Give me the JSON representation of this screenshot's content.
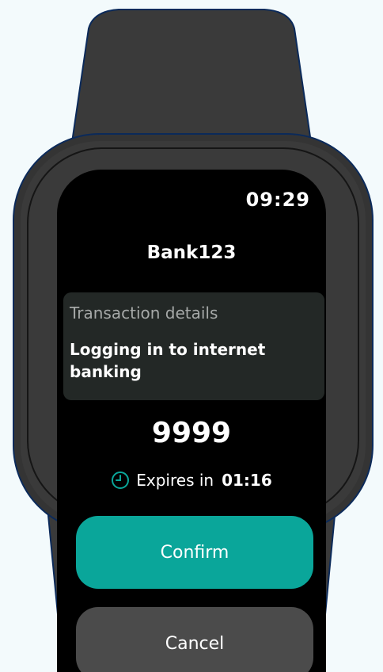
{
  "status_bar": {
    "time": "09:29"
  },
  "app": {
    "title": "Bank123"
  },
  "transaction": {
    "label": "Transaction details",
    "description": "Logging in to internet banking"
  },
  "code": "9999",
  "expiry": {
    "label": "Expires in",
    "value": "01:16",
    "icon": "clock-icon"
  },
  "actions": {
    "confirm_label": "Confirm",
    "cancel_label": "Cancel"
  },
  "colors": {
    "accent": "#0aa69a",
    "cancel": "#4b4b4b",
    "screen": "#000000",
    "card": "#232826",
    "watch_body": "#3a3a3a",
    "background": "#f3fafc"
  }
}
